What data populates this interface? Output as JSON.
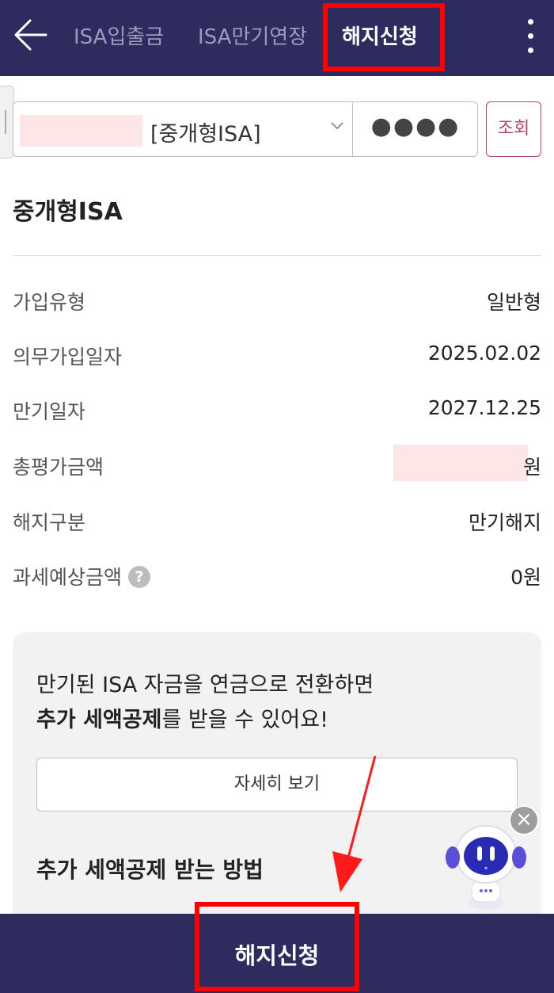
{
  "header": {
    "tabs": [
      {
        "label": "ISA입출금"
      },
      {
        "label": "ISA만기연장"
      },
      {
        "label": "해지신청"
      }
    ]
  },
  "account": {
    "type_label": "[중개형ISA]",
    "password_mask": "●●●●",
    "search_label": "조회"
  },
  "section_title": "중개형ISA",
  "info": [
    {
      "label": "가입유형",
      "value": "일반형"
    },
    {
      "label": "의무가입일자",
      "value": "2025.02.02"
    },
    {
      "label": "만기일자",
      "value": "2027.12.25"
    },
    {
      "label": "총평가금액",
      "value": "원"
    },
    {
      "label": "해지구분",
      "value": "만기해지"
    },
    {
      "label": "과세예상금액",
      "value": "0원"
    }
  ],
  "help_icon": "?",
  "promo": {
    "line1": "만기된 ISA 자금을 연금으로 전환하면",
    "line2_bold": "추가 세액공제",
    "line2_rest": "를 받을 수 있어요!",
    "detail_button": "자세히 보기",
    "subtitle": "추가 세액공제 받는 방법"
  },
  "bottom_button": "해지신청",
  "chatbot_close": "×",
  "colors": {
    "header_bg": "#2e2c5e",
    "accent": "#b5436b",
    "highlight": "#ff0000",
    "redaction": "#ffe6e6"
  },
  "icons": [
    "back-arrow-icon",
    "more-vert-icon",
    "chevron-down-icon",
    "help-icon",
    "chatbot-icon",
    "close-icon"
  ]
}
